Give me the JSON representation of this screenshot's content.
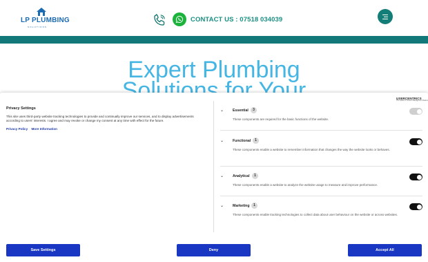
{
  "header": {
    "logo_text": "LP PLUMBING",
    "logo_tagline": "SOLUTIONS",
    "contact_label": "CONTACT US : 07518 034039"
  },
  "hero": {
    "line1": "Expert Plumbing",
    "line2": "Solutions for Your"
  },
  "consent": {
    "title": "Privacy Settings",
    "description": "This site uses third-party website tracking technologies to provide and continually improve our services, and to display advertisements according to users' interests. I agree and may revoke or change my consent at any time with effect for the future.",
    "links": [
      "Privacy Policy",
      "More Information"
    ],
    "brand": "USERCENTRICS",
    "brand_sub": "The Leader in Consent Management Platforms",
    "categories": [
      {
        "name": "Essential",
        "count": "3",
        "description": "These components are required for the basic functions of the website.",
        "enabled": true,
        "locked": true
      },
      {
        "name": "Functional",
        "count": "1",
        "description": "These components enable a website to remember information that changes the way the website looks or behaves.",
        "enabled": false,
        "locked": false
      },
      {
        "name": "Analytical",
        "count": "1",
        "description": "These components enable a website to analyze the website usage to measure and improve performance.",
        "enabled": false,
        "locked": false
      },
      {
        "name": "Marketing",
        "count": "1",
        "description": "These components enable tracking technologies to collect data about user behaviour on the website or across websites.",
        "enabled": false,
        "locked": false
      }
    ],
    "buttons": {
      "save": "Save Settings",
      "deny": "Deny",
      "accept": "Accept All"
    }
  },
  "colors": {
    "teal": "#12787a",
    "brand_blue": "#1b6bb3",
    "hero_blue": "#45b6e3",
    "button_blue": "#1a37c4",
    "whatsapp": "#1cb33d"
  }
}
